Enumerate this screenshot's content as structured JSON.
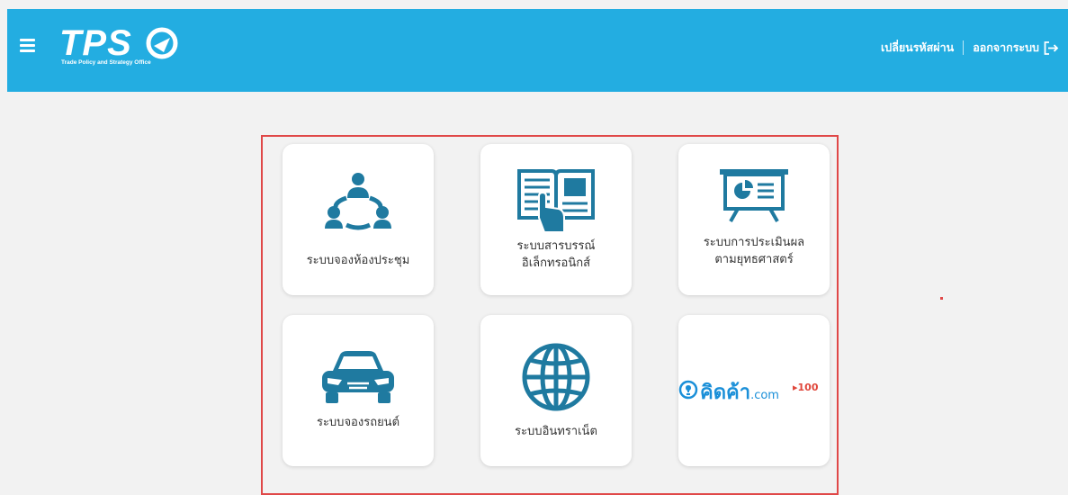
{
  "header": {
    "logo_text": "TPS",
    "logo_subtitle": "Trade Policy and Strategy Office",
    "change_password": "เปลี่ยนรหัสผ่าน",
    "logout": "ออกจากระบบ"
  },
  "menu": {
    "items": [
      {
        "label": "ระบบจองห้องประชุม",
        "icon": "meeting-people-icon"
      },
      {
        "label": "ระบบสารบรรณ์\nอิเล็กทรอนิกส์",
        "icon": "open-book-hand-icon"
      },
      {
        "label": "ระบบการประเมินผล\nตามยุทธศาสตร์",
        "icon": "presentation-board-icon"
      },
      {
        "label": "ระบบจองรถยนต์",
        "icon": "car-icon"
      },
      {
        "label": "ระบบอินทราเน็ต",
        "icon": "globe-icon"
      },
      {
        "brand_text": "คิดค้า",
        "brand_suffix": ".com",
        "brand_badge": "100",
        "icon": "lightbulb-icon"
      }
    ]
  },
  "colors": {
    "header": "#23ade1",
    "icon": "#1f7aa0",
    "frame": "#e04848"
  }
}
